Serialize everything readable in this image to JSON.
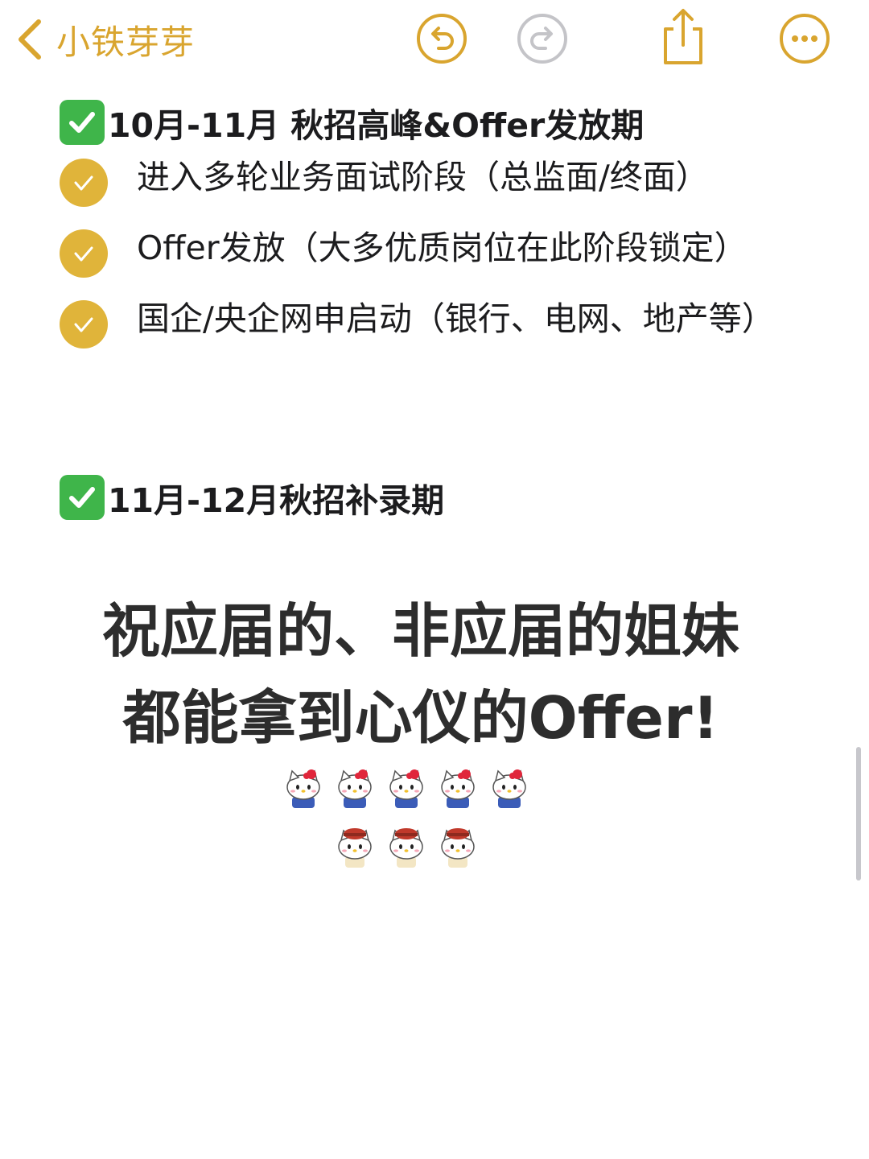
{
  "navbar": {
    "back_label": "小铁芽芽",
    "accent_color": "#d9a52f",
    "icons": [
      "chevron-left-icon",
      "undo-icon",
      "redo-icon",
      "share-icon",
      "more-icon"
    ]
  },
  "note": {
    "heading_1": "10月-11月 秋招高峰&Offer发放期",
    "items": [
      {
        "text": "进入多轮业务面试阶段（总监面/终面）"
      },
      {
        "text": "Offer发放（大多优质岗位在此阶段锁定）"
      },
      {
        "text": "国企/央企网申启动（银行、电网、地产等）"
      }
    ],
    "heading_2": "11月-12月秋招补录期",
    "closing_line_1": "祝应届的、非应届的姐妹",
    "closing_line_2": "都能拿到心仪的Offer!",
    "sticker_rows": [
      5,
      3
    ],
    "check_color": "#e0b43a",
    "green_check_color": "#3fb54a"
  }
}
